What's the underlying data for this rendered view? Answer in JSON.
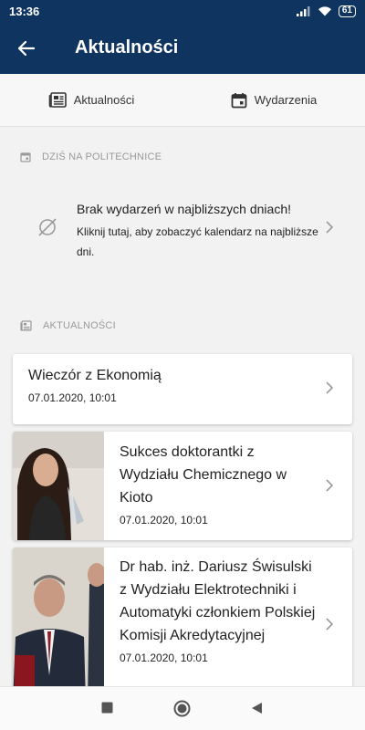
{
  "status_bar": {
    "time": "13:36",
    "battery": "61"
  },
  "app_bar": {
    "title": "Aktualności",
    "back_icon": "arrow-left-icon"
  },
  "tabs": [
    {
      "label": "Aktualności",
      "icon": "newspaper-icon"
    },
    {
      "label": "Wydarzenia",
      "icon": "calendar-icon"
    }
  ],
  "today_section": {
    "header": "DZIŚ NA POLITECHNICE",
    "empty_title": "Brak wydarzeń w najbliższych dniach!",
    "empty_subtitle": "Kliknij tutaj, aby zobaczyć kalendarz na najbliższe dni."
  },
  "news_section": {
    "header": "AKTUALNOŚCI",
    "items": [
      {
        "title": "Wieczór z Ekonomią",
        "date": "07.01.2020, 10:01",
        "has_image": false
      },
      {
        "title": "Sukces doktorantki z Wydziału Chemicznego w Kioto",
        "date": "07.01.2020, 10:01",
        "has_image": true
      },
      {
        "title": "Dr hab. inż. Dariusz Świsulski z Wydziału Elektrotechniki i Automatyki członkiem Polskiej Komisji Akredytacyjnej",
        "date": "07.01.2020, 10:01",
        "has_image": true
      }
    ]
  },
  "colors": {
    "primary": "#0f3460",
    "background": "#f2f2f2",
    "card": "#ffffff",
    "muted": "#9a9a9a"
  }
}
